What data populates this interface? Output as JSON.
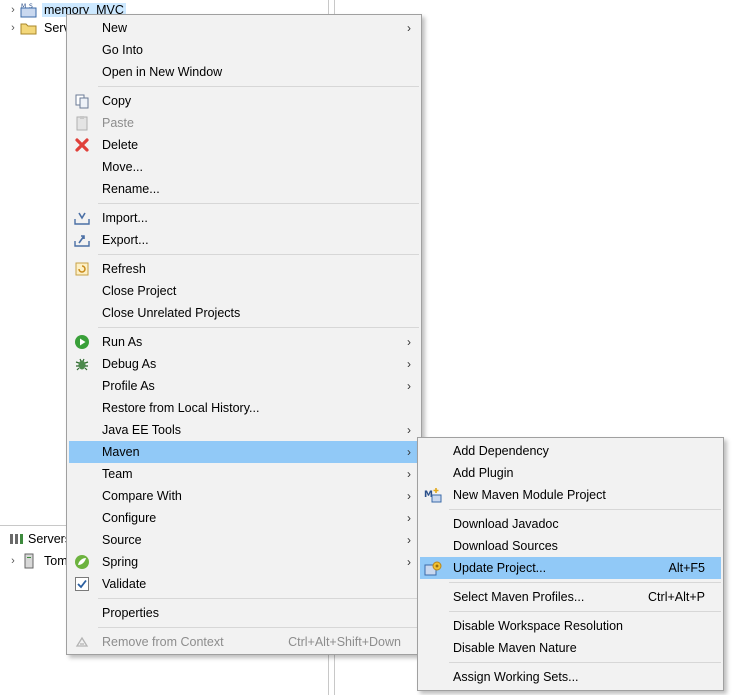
{
  "explorer": {
    "items": [
      {
        "label": "memory_MVC",
        "selected": true,
        "icon": "maven-project-icon"
      },
      {
        "label": "Serv",
        "selected": false,
        "icon": "folder-icon"
      }
    ]
  },
  "servers_panel": {
    "tab_label": "Servers",
    "items": [
      {
        "label": "Tom",
        "icon": "server-icon"
      }
    ]
  },
  "context_menu": {
    "items": [
      {
        "label": "New",
        "submenu": true
      },
      {
        "label": "Go Into"
      },
      {
        "label": "Open in New Window"
      },
      {
        "label": "Copy",
        "icon": "copy-icon"
      },
      {
        "label": "Paste",
        "icon": "paste-icon",
        "disabled": true
      },
      {
        "label": "Delete",
        "icon": "delete-icon"
      },
      {
        "label": "Move..."
      },
      {
        "label": "Rename..."
      },
      {
        "label": "Import...",
        "icon": "import-icon"
      },
      {
        "label": "Export...",
        "icon": "export-icon"
      },
      {
        "label": "Refresh",
        "icon": "refresh-icon"
      },
      {
        "label": "Close Project"
      },
      {
        "label": "Close Unrelated Projects"
      },
      {
        "label": "Run As",
        "icon": "run-icon",
        "submenu": true
      },
      {
        "label": "Debug As",
        "icon": "debug-icon",
        "submenu": true
      },
      {
        "label": "Profile As",
        "submenu": true
      },
      {
        "label": "Restore from Local History..."
      },
      {
        "label": "Java EE Tools",
        "submenu": true
      },
      {
        "label": "Maven",
        "submenu": true,
        "highlighted": true
      },
      {
        "label": "Team",
        "submenu": true
      },
      {
        "label": "Compare With",
        "submenu": true
      },
      {
        "label": "Configure",
        "submenu": true
      },
      {
        "label": "Source",
        "submenu": true
      },
      {
        "label": "Spring",
        "icon": "spring-icon",
        "submenu": true
      },
      {
        "label": "Validate",
        "icon": "checkbox-checked-icon"
      },
      {
        "label": "Properties"
      },
      {
        "label": "Remove from Context",
        "icon": "remove-context-icon",
        "disabled": true,
        "shortcut": "Ctrl+Alt+Shift+Down"
      }
    ]
  },
  "maven_submenu": {
    "items": [
      {
        "label": "Add Dependency"
      },
      {
        "label": "Add Plugin"
      },
      {
        "label": "New Maven Module Project",
        "icon": "maven-module-icon"
      },
      {
        "label": "Download Javadoc"
      },
      {
        "label": "Download Sources"
      },
      {
        "label": "Update Project...",
        "icon": "update-project-icon",
        "shortcut": "Alt+F5",
        "highlighted": true
      },
      {
        "label": "Select Maven Profiles...",
        "shortcut": "Ctrl+Alt+P"
      },
      {
        "label": "Disable Workspace Resolution"
      },
      {
        "label": "Disable Maven Nature"
      },
      {
        "label": "Assign Working Sets..."
      }
    ]
  },
  "colors": {
    "menu_bg": "#f2f2f2",
    "highlight": "#91c9f7",
    "selection": "#cce8ff",
    "disabled_text": "#8d8d8d"
  }
}
